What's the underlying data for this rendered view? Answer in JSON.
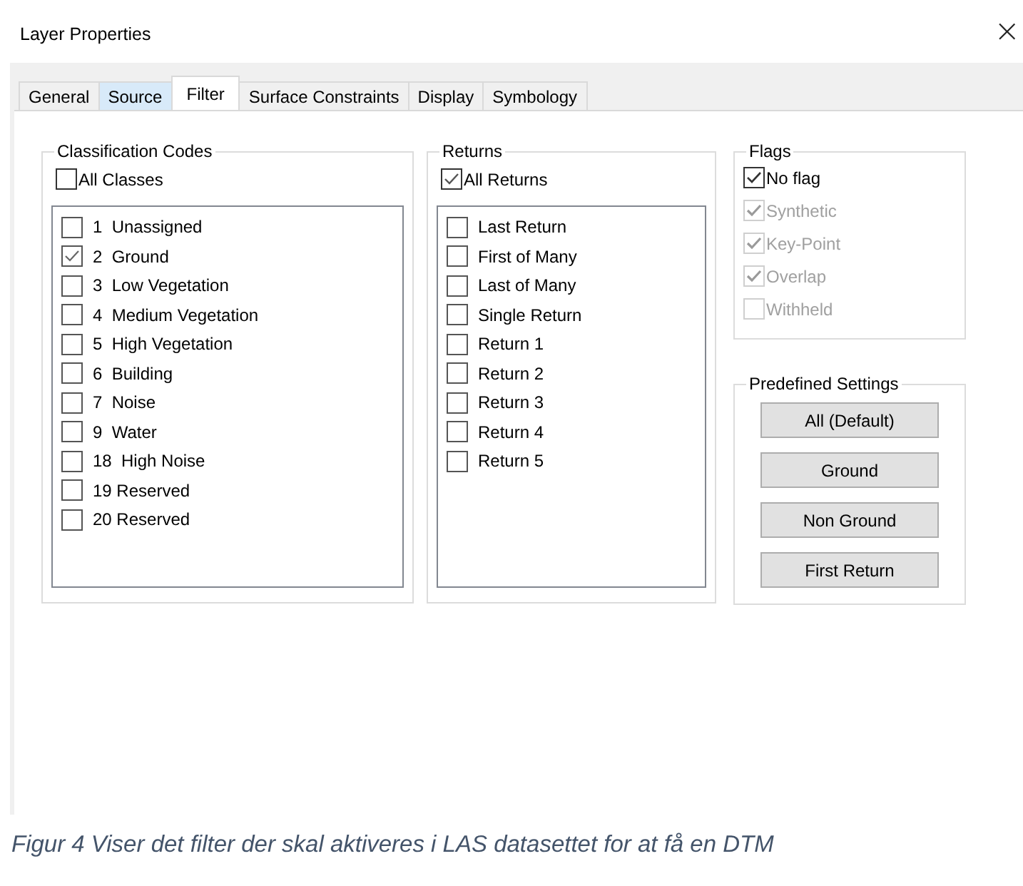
{
  "window": {
    "title": "Layer Properties",
    "close": "×"
  },
  "tabs": [
    {
      "label": "General",
      "selected": false,
      "hovered": false
    },
    {
      "label": "Source",
      "selected": false,
      "hovered": true
    },
    {
      "label": "Filter",
      "selected": true,
      "hovered": false
    },
    {
      "label": "Surface Constraints",
      "selected": false,
      "hovered": false
    },
    {
      "label": "Display",
      "selected": false,
      "hovered": false
    },
    {
      "label": "Symbology",
      "selected": false,
      "hovered": false
    }
  ],
  "classification_codes": {
    "title": "Classification Codes",
    "all": {
      "label": "All Classes",
      "checked": false
    },
    "items": [
      {
        "label": "1  Unassigned",
        "checked": false
      },
      {
        "label": "2  Ground",
        "checked": true
      },
      {
        "label": "3  Low Vegetation",
        "checked": false
      },
      {
        "label": "4  Medium Vegetation",
        "checked": false
      },
      {
        "label": "5  High Vegetation",
        "checked": false
      },
      {
        "label": "6  Building",
        "checked": false
      },
      {
        "label": "7  Noise",
        "checked": false
      },
      {
        "label": "9  Water",
        "checked": false
      },
      {
        "label": "18  High Noise",
        "checked": false
      },
      {
        "label": "19 Reserved",
        "checked": false
      },
      {
        "label": "20 Reserved",
        "checked": false
      }
    ]
  },
  "returns": {
    "title": "Returns",
    "all": {
      "label": "All Returns",
      "checked": true
    },
    "items": [
      {
        "label": "Last Return",
        "checked": false
      },
      {
        "label": "First of Many",
        "checked": false
      },
      {
        "label": "Last of Many",
        "checked": false
      },
      {
        "label": "Single Return",
        "checked": false
      },
      {
        "label": "Return 1",
        "checked": false
      },
      {
        "label": "Return 2",
        "checked": false
      },
      {
        "label": "Return 3",
        "checked": false
      },
      {
        "label": "Return 4",
        "checked": false
      },
      {
        "label": "Return 5",
        "checked": false
      }
    ]
  },
  "flags": {
    "title": "Flags",
    "items": [
      {
        "label": "No flag",
        "checked": true,
        "disabled": false
      },
      {
        "label": "Synthetic",
        "checked": true,
        "disabled": true
      },
      {
        "label": "Key-Point",
        "checked": true,
        "disabled": true
      },
      {
        "label": "Overlap",
        "checked": true,
        "disabled": true
      },
      {
        "label": "Withheld",
        "checked": false,
        "disabled": true
      }
    ]
  },
  "predefined_settings": {
    "title": "Predefined Settings",
    "buttons": [
      "All (Default)",
      "Ground",
      "Non Ground",
      "First Return"
    ]
  },
  "caption": "Figur 4 Viser det filter der skal aktiveres i LAS datasettet for at få en DTM"
}
